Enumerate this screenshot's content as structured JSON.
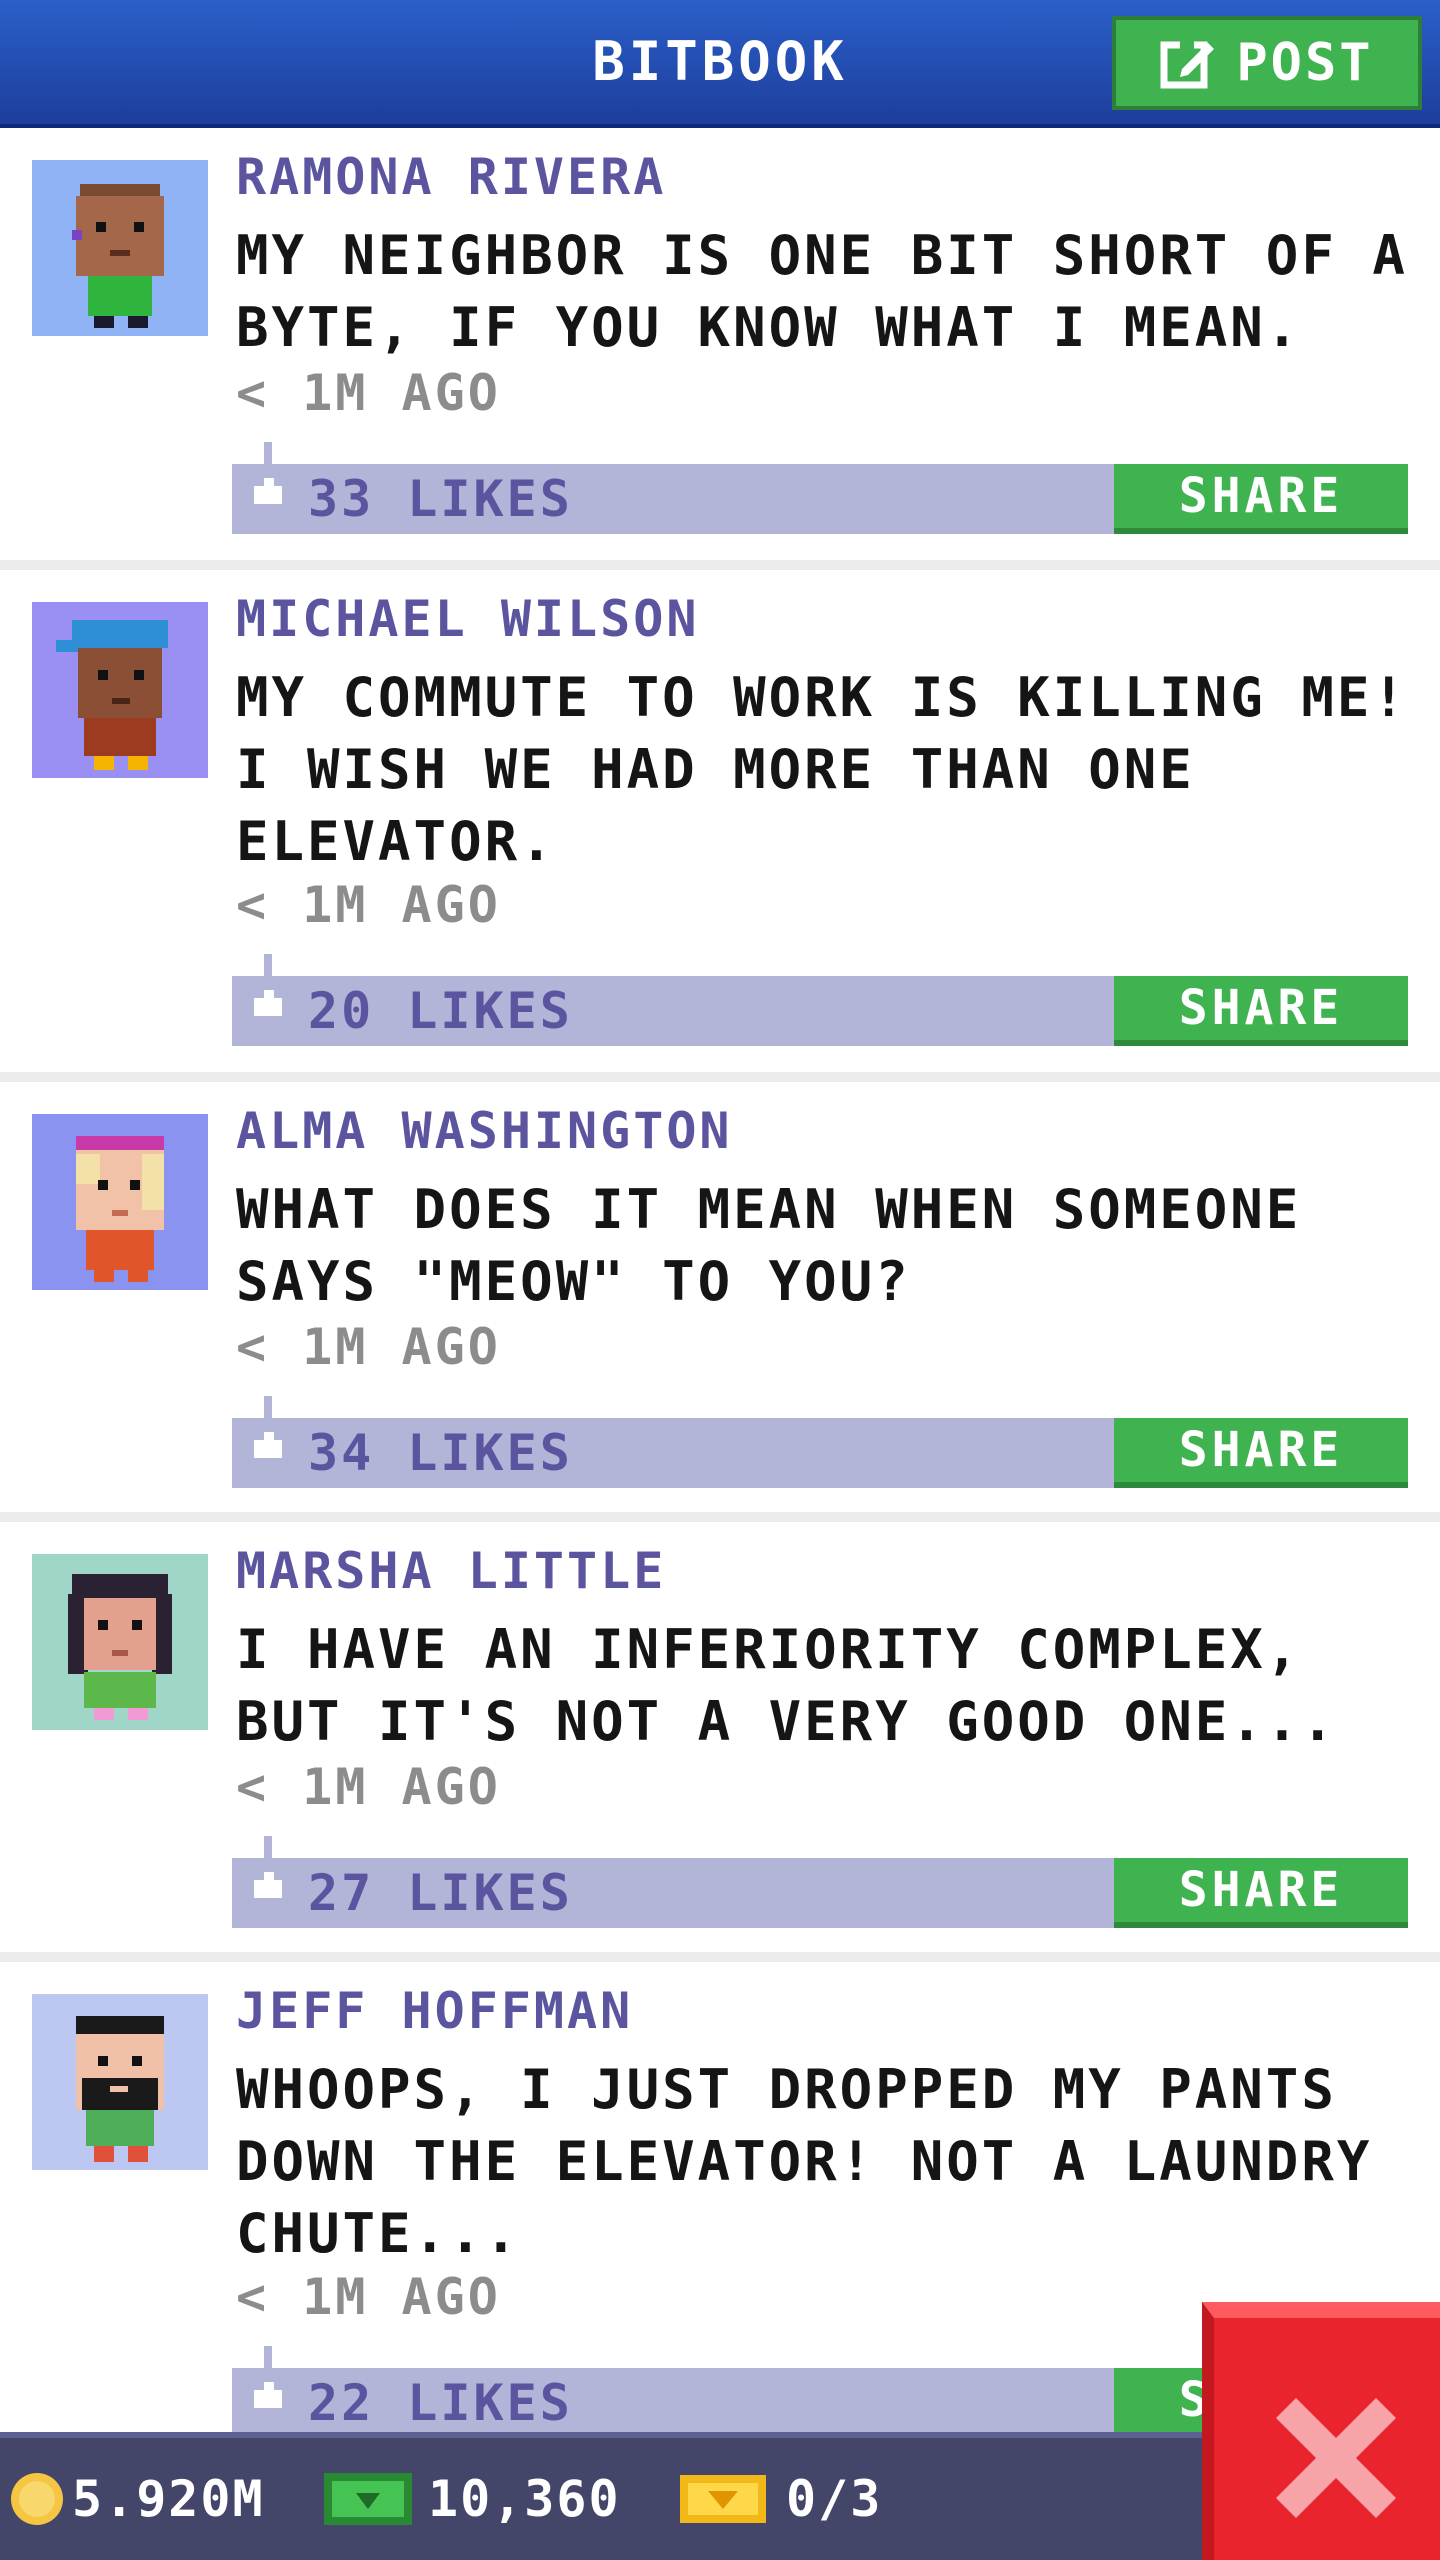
{
  "header": {
    "title": "BITBOOK",
    "post_label": "POST"
  },
  "posts": [
    {
      "author": "RAMONA RIVERA",
      "message": "MY NEIGHBOR IS ONE BIT SHORT OF A BYTE, IF YOU KNOW WHAT I MEAN.",
      "time": "< 1M AGO",
      "likes": "33 LIKES",
      "share": "SHARE"
    },
    {
      "author": "MICHAEL WILSON",
      "message": "MY COMMUTE TO WORK IS KILLING ME! I WISH WE HAD MORE THAN ONE ELEVATOR.",
      "time": "< 1M AGO",
      "likes": "20 LIKES",
      "share": "SHARE"
    },
    {
      "author": "ALMA WASHINGTON",
      "message": "WHAT DOES IT MEAN WHEN SOMEONE SAYS \"MEOW\" TO YOU?",
      "time": "< 1M AGO",
      "likes": "34 LIKES",
      "share": "SHARE"
    },
    {
      "author": "MARSHA LITTLE",
      "message": "I HAVE AN INFERIORITY COMPLEX, BUT IT'S NOT A VERY GOOD ONE...",
      "time": "< 1M AGO",
      "likes": "27 LIKES",
      "share": "SHARE"
    },
    {
      "author": "JEFF HOFFMAN",
      "message": "WHOOPS, I JUST DROPPED MY PANTS DOWN THE ELEVATOR! NOT A LAUNDRY CHUTE...",
      "time": "< 1M AGO",
      "likes": "22 LIKES",
      "share": "SHARE"
    }
  ],
  "footer": {
    "coins": "5.920M",
    "bux": "10,360",
    "tickets": "0/3"
  },
  "colors": {
    "header_blue": "#2b5fc9",
    "share_green": "#3fb34f",
    "likes_bar": "#b2b4d8",
    "author_purple": "#5b55a0",
    "close_red": "#e9242d"
  }
}
